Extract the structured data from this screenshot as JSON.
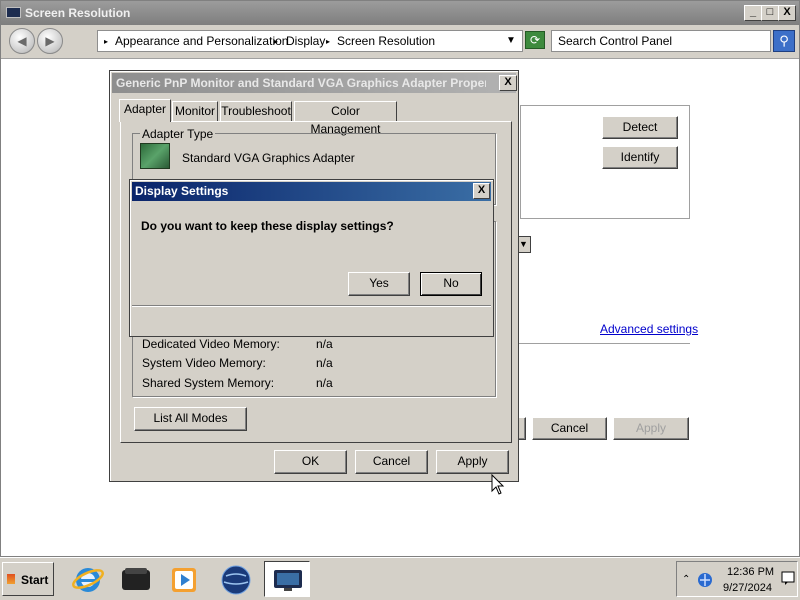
{
  "window": {
    "title": "Screen Resolution",
    "minimize": "_",
    "maximize": "□",
    "close": "X"
  },
  "address": {
    "crumbs": [
      "Appearance and Personalization",
      "Display",
      "Screen Resolution"
    ],
    "search_placeholder": "Search Control Panel"
  },
  "background": {
    "detect_label": "Detect",
    "identify_label": "Identify",
    "advanced_link": "Advanced settings",
    "cancel_label": "Cancel",
    "apply_label": "Apply"
  },
  "adapter_dialog": {
    "title": "Generic PnP Monitor and Standard VGA Graphics Adapter Properties",
    "tabs": [
      "Adapter",
      "Monitor",
      "Troubleshoot",
      "Color Management"
    ],
    "adapter_type_label": "Adapter Type",
    "adapter_name": "Standard VGA Graphics Adapter",
    "info": [
      {
        "label": "Dedicated Video Memory:",
        "value": "n/a"
      },
      {
        "label": "System Video Memory:",
        "value": "n/a"
      },
      {
        "label": "Shared System Memory:",
        "value": "n/a"
      }
    ],
    "list_modes_label": "List All Modes",
    "ok_label": "OK",
    "cancel_label": "Cancel",
    "apply_label": "Apply",
    "close": "X"
  },
  "display_settings_dialog": {
    "title": "Display Settings",
    "question": "Do you want to keep these display settings?",
    "yes_label": "Yes",
    "no_label": "No",
    "close": "X"
  },
  "taskbar": {
    "start_label": "Start",
    "clock_time": "12:36 PM",
    "clock_date": "9/27/2024"
  },
  "icons": [
    "back-icon",
    "forward-icon",
    "refresh-icon",
    "search-icon",
    "internet-explorer-icon",
    "media-center-icon",
    "media-player-icon",
    "globe-icon",
    "display-icon",
    "network-icon"
  ]
}
